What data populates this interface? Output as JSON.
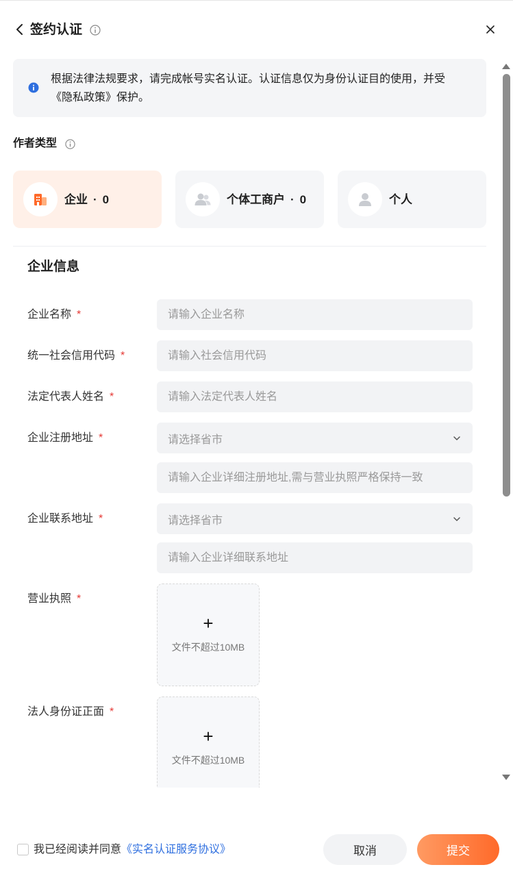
{
  "header": {
    "title": "签约认证",
    "close": "×"
  },
  "notice": {
    "text": "根据法律法规要求，请完成帐号实名认证。认证信息仅为身份认证目的使用，并受《隐私政策》保护。"
  },
  "author_type": {
    "label": "作者类型",
    "cards": [
      {
        "label": "企业",
        "count": "0",
        "active": true,
        "icon": "building-icon"
      },
      {
        "label": "个体工商户",
        "count": "0",
        "active": false,
        "icon": "users-icon"
      },
      {
        "label": "个人",
        "count": "",
        "active": false,
        "icon": "user-icon"
      }
    ],
    "dot": "·"
  },
  "section": {
    "title": "企业信息"
  },
  "form": {
    "required_mark": "*",
    "company_name": {
      "label": "企业名称",
      "placeholder": "请输入企业名称"
    },
    "credit_code": {
      "label": "统一社会信用代码",
      "placeholder": "请输入社会信用代码"
    },
    "legal_rep": {
      "label": "法定代表人姓名",
      "placeholder": "请输入法定代表人姓名"
    },
    "reg_address": {
      "label": "企业注册地址",
      "select_placeholder": "请选择省市",
      "detail_placeholder": "请输入企业详细注册地址,需与营业执照严格保持一致"
    },
    "contact_address": {
      "label": "企业联系地址",
      "select_placeholder": "请选择省市",
      "detail_placeholder": "请输入企业详细联系地址"
    },
    "license": {
      "label": "营业执照",
      "plus": "+",
      "hint": "文件不超过10MB"
    },
    "id_front": {
      "label": "法人身份证正面",
      "plus": "+",
      "hint": "文件不超过10MB"
    }
  },
  "footer": {
    "agree_text": "我已经阅读并同意",
    "agree_link": "《实名认证服务协议》",
    "cancel": "取消",
    "submit": "提交"
  },
  "colors": {
    "accent": "#ff6a2a",
    "active_card_bg": "#fff0e8",
    "link": "#2f6fdf",
    "required": "#e53935",
    "info_blue": "#2f6fdf"
  }
}
